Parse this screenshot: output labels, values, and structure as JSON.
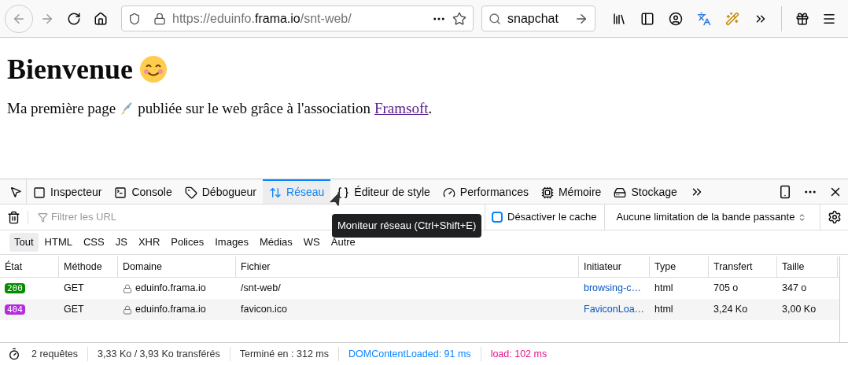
{
  "browser": {
    "url_prefix": "https://eduinfo.",
    "url_domain": "frama.io",
    "url_path": "/snt-web/",
    "search_value": "snapchat"
  },
  "page": {
    "heading": "Bienvenue",
    "text_before": "Ma première page",
    "text_after": "publiée sur le web grâce à l'association",
    "link": "Framsoft",
    "text_end": "."
  },
  "devtools": {
    "tabs": [
      {
        "label": "Inspecteur",
        "selected": false
      },
      {
        "label": "Console",
        "selected": false
      },
      {
        "label": "Débogueur",
        "selected": false
      },
      {
        "label": "Réseau",
        "selected": true
      },
      {
        "label": "Éditeur de style",
        "selected": false
      },
      {
        "label": "Performances",
        "selected": false
      },
      {
        "label": "Mémoire",
        "selected": false
      },
      {
        "label": "Stockage",
        "selected": false
      }
    ],
    "disable_cache_checked": false,
    "filter_placeholder": "Filtrer les URL",
    "disable_cache_label": "Désactiver le cache",
    "throttling": "Aucune limitation de la bande passante",
    "tooltip": "Moniteur réseau (Ctrl+Shift+E)",
    "type_filters": [
      {
        "label": "Tout",
        "selected": true
      },
      {
        "label": "HTML",
        "selected": false
      },
      {
        "label": "CSS",
        "selected": false
      },
      {
        "label": "JS",
        "selected": false
      },
      {
        "label": "XHR",
        "selected": false
      },
      {
        "label": "Polices",
        "selected": false
      },
      {
        "label": "Images",
        "selected": false
      },
      {
        "label": "Médias",
        "selected": false
      },
      {
        "label": "WS",
        "selected": false
      },
      {
        "label": "Autre",
        "selected": false
      }
    ],
    "table": {
      "columns": [
        "État",
        "Méthode",
        "Domaine",
        "Fichier",
        "Initiateur",
        "Type",
        "Transfert",
        "Taille"
      ],
      "rows": [
        {
          "status": "200",
          "color": "#058b00",
          "method": "GET",
          "domain": "eduinfo.frama.io",
          "file": "/snt-web/",
          "initiator": "browsing-c…",
          "type": "html",
          "transfer": "705 o",
          "size": "347 o"
        },
        {
          "status": "404",
          "color": "#b42bdf",
          "method": "GET",
          "domain": "eduinfo.frama.io",
          "file": "favicon.ico",
          "initiator": "FaviconLoa…",
          "type": "html",
          "transfer": "3,24 Ko",
          "size": "3,00 Ko"
        }
      ]
    },
    "status_bar": [
      {
        "text": "2 requêtes",
        "kind": "plain"
      },
      {
        "text": "3,33 Ko / 3,93 Ko transférés",
        "kind": "plain"
      },
      {
        "text": "Terminé en : 312 ms",
        "kind": "plain"
      },
      {
        "text": "DOMContentLoaded: 91 ms",
        "kind": "dom"
      },
      {
        "text": "load: 102 ms",
        "kind": "load"
      }
    ]
  }
}
